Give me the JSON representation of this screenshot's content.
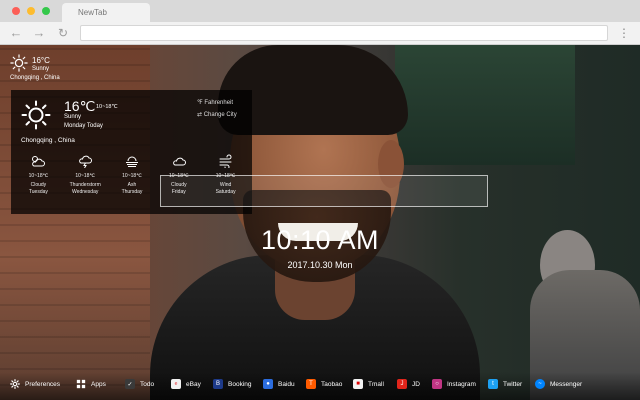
{
  "browser": {
    "tab_title": "NewTab",
    "address": "",
    "back_icon": "back-arrow-icon",
    "forward_icon": "forward-arrow-icon",
    "reload_icon": "reload-icon",
    "menu_icon": "menu-icon"
  },
  "mini_weather": {
    "temp": "16°C",
    "condition": "Sunny",
    "location": "Chongqing , China",
    "icon": "sun-icon"
  },
  "weather_panel": {
    "temp": "16℃",
    "range": "10~18℃",
    "condition": "Sunny",
    "day": "Monday Today",
    "location": "Chongqing , China",
    "fahrenheit_label": "℉ Fahrenheit",
    "change_city_label": "⇄ Change City",
    "forecast": [
      {
        "range": "10~18℃",
        "condition": "Cloudy",
        "day": "Tuesday",
        "icon": "cloudy-icon"
      },
      {
        "range": "10~18℃",
        "condition": "Thunderstorm",
        "day": "Wednesday",
        "icon": "thunderstorm-icon"
      },
      {
        "range": "10~18℃",
        "condition": "Ash",
        "day": "Thursday",
        "icon": "ash-icon"
      },
      {
        "range": "10~18℃",
        "condition": "Cloudy",
        "day": "Friday",
        "icon": "cloud-icon"
      },
      {
        "range": "10~18℃",
        "condition": "Wind",
        "day": "Saturday",
        "icon": "wind-icon"
      }
    ]
  },
  "search": {
    "placeholder": ""
  },
  "clock": {
    "time": "10:10 AM",
    "date": "2017.10.30 Mon"
  },
  "bottom_bar": {
    "preferences": "Preferences",
    "apps": "Apps",
    "links": [
      {
        "label": "Todo",
        "icon": "todo-icon",
        "color": "#3a3a3a"
      },
      {
        "label": "eBay",
        "icon": "ebay-icon",
        "color": "#f2f2f2"
      },
      {
        "label": "Booking",
        "icon": "booking-icon",
        "color": "#1d3a8a"
      },
      {
        "label": "Baidu",
        "icon": "baidu-icon",
        "color": "#2b6de0"
      },
      {
        "label": "Taobao",
        "icon": "taobao-icon",
        "color": "#ff5b00"
      },
      {
        "label": "Tmall",
        "icon": "tmall-icon",
        "color": "#f2f2f2"
      },
      {
        "label": "JD",
        "icon": "jd-icon",
        "color": "#e1251b"
      },
      {
        "label": "Instagram",
        "icon": "instagram-icon",
        "color": "#c13584"
      },
      {
        "label": "Twitter",
        "icon": "twitter-icon",
        "color": "#1da1f2"
      },
      {
        "label": "Messenger",
        "icon": "messenger-icon",
        "color": "#0084ff"
      }
    ]
  }
}
